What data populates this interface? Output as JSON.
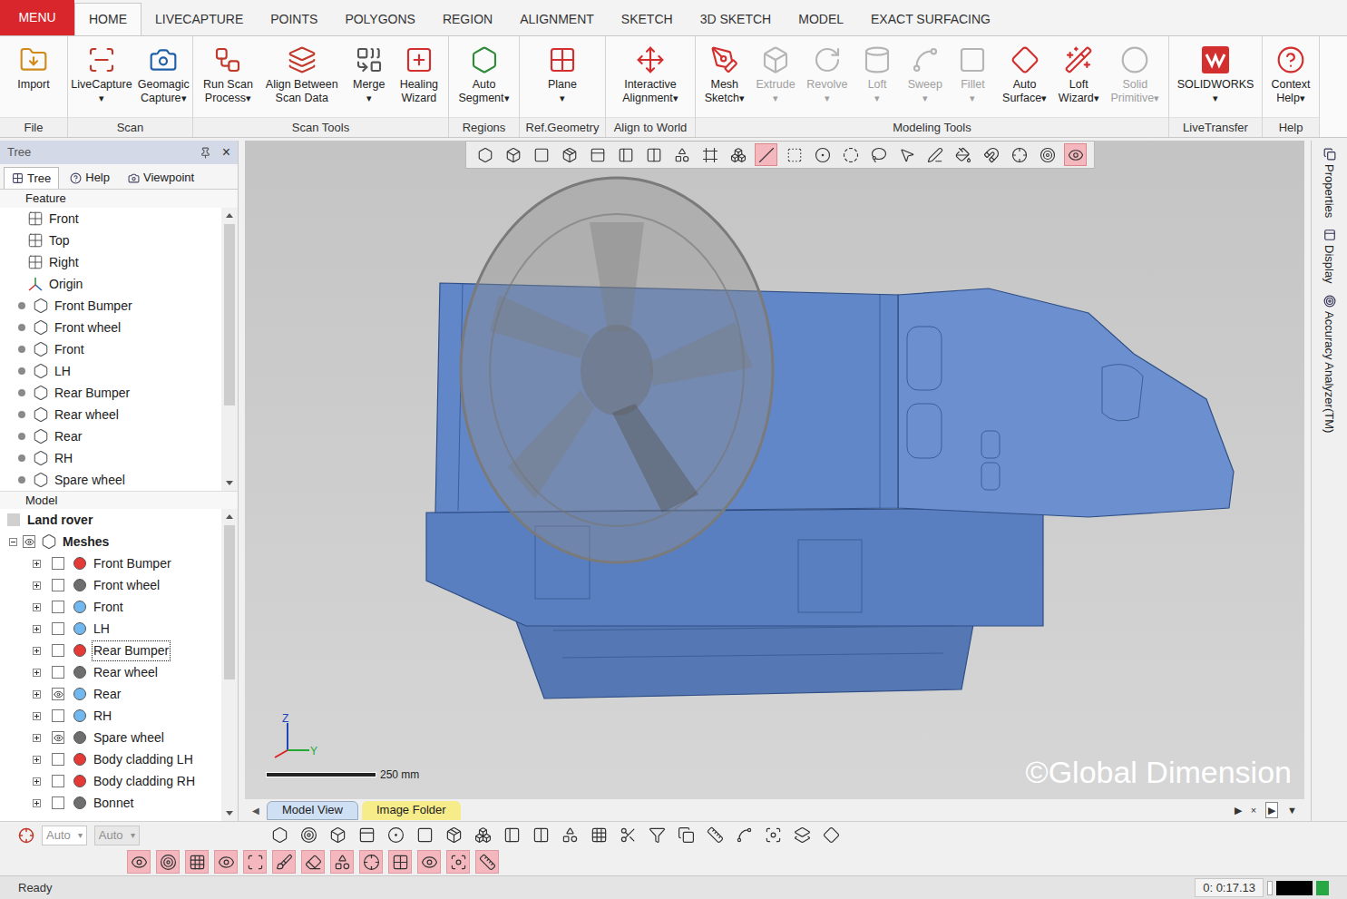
{
  "menu": "MENU",
  "tabs": [
    {
      "label": "HOME",
      "selected": true
    },
    {
      "label": "LIVECAPTURE",
      "selected": false
    },
    {
      "label": "POINTS",
      "selected": false
    },
    {
      "label": "POLYGONS",
      "selected": false
    },
    {
      "label": "REGION",
      "selected": false
    },
    {
      "label": "ALIGNMENT",
      "selected": false
    },
    {
      "label": "SKETCH",
      "selected": false
    },
    {
      "label": "3D SKETCH",
      "selected": false
    },
    {
      "label": "MODEL",
      "selected": false
    },
    {
      "label": "EXACT SURFACING",
      "selected": false
    }
  ],
  "dropdown_glyph": "▾",
  "ribbon_groups": [
    {
      "label": "File",
      "buttons": [
        {
          "lines": [
            "Import"
          ],
          "arrow": "none",
          "disabled": false
        }
      ]
    },
    {
      "label": "Scan",
      "buttons": [
        {
          "lines": [
            "LiveCapture"
          ],
          "arrow": "below",
          "disabled": false
        },
        {
          "lines": [
            "Geomagic",
            "Capture"
          ],
          "arrow": "inline",
          "disabled": false
        }
      ]
    },
    {
      "label": "Scan Tools",
      "buttons": [
        {
          "lines": [
            "Run Scan",
            "Process"
          ],
          "arrow": "inline",
          "disabled": false
        },
        {
          "lines": [
            "Align Between",
            "Scan Data"
          ],
          "arrow": "none",
          "disabled": false
        },
        {
          "lines": [
            "Merge"
          ],
          "arrow": "below",
          "disabled": false
        },
        {
          "lines": [
            "Healing",
            "Wizard"
          ],
          "arrow": "none",
          "disabled": false
        }
      ]
    },
    {
      "label": "Regions",
      "buttons": [
        {
          "lines": [
            "Auto",
            "Segment"
          ],
          "arrow": "inline",
          "disabled": false
        }
      ]
    },
    {
      "label": "Ref.Geometry",
      "buttons": [
        {
          "lines": [
            "Plane"
          ],
          "arrow": "below",
          "disabled": false
        }
      ]
    },
    {
      "label": "Align to World",
      "buttons": [
        {
          "lines": [
            "Interactive",
            "Alignment"
          ],
          "arrow": "inline",
          "disabled": false
        }
      ]
    },
    {
      "label": "Modeling Tools",
      "buttons": [
        {
          "lines": [
            "Mesh",
            "Sketch"
          ],
          "arrow": "inline",
          "disabled": false
        },
        {
          "lines": [
            "Extrude"
          ],
          "arrow": "below",
          "disabled": true
        },
        {
          "lines": [
            "Revolve"
          ],
          "arrow": "below",
          "disabled": true
        },
        {
          "lines": [
            "Loft"
          ],
          "arrow": "below",
          "disabled": true
        },
        {
          "lines": [
            "Sweep"
          ],
          "arrow": "below",
          "disabled": true
        },
        {
          "lines": [
            "Fillet"
          ],
          "arrow": "below",
          "disabled": true
        },
        {
          "lines": [
            "Auto",
            "Surface"
          ],
          "arrow": "inline",
          "disabled": false
        },
        {
          "lines": [
            "Loft",
            "Wizard"
          ],
          "arrow": "inline",
          "disabled": false
        },
        {
          "lines": [
            "Solid",
            "Primitive"
          ],
          "arrow": "inline",
          "disabled": true
        }
      ]
    },
    {
      "label": "LiveTransfer",
      "buttons": [
        {
          "lines": [
            "SOLIDWORKS"
          ],
          "arrow": "below",
          "disabled": false
        }
      ]
    },
    {
      "label": "Help",
      "buttons": [
        {
          "lines": [
            "Context",
            "Help"
          ],
          "arrow": "inline",
          "disabled": false
        }
      ]
    }
  ],
  "tree_panel": {
    "title": "Tree",
    "close": "×",
    "tabs": [
      {
        "label": "Tree",
        "selected": true
      },
      {
        "label": "Help",
        "selected": false
      },
      {
        "label": "Viewpoint",
        "selected": false
      }
    ],
    "feature_header": "Feature",
    "features": [
      {
        "label": "Front",
        "kind": "plane"
      },
      {
        "label": "Top",
        "kind": "plane"
      },
      {
        "label": "Right",
        "kind": "plane"
      },
      {
        "label": "Origin",
        "kind": "origin"
      },
      {
        "label": "Front Bumper",
        "kind": "mesh"
      },
      {
        "label": "Front wheel",
        "kind": "mesh"
      },
      {
        "label": "Front",
        "kind": "mesh"
      },
      {
        "label": "LH",
        "kind": "mesh"
      },
      {
        "label": "Rear Bumper",
        "kind": "mesh"
      },
      {
        "label": "Rear wheel",
        "kind": "mesh"
      },
      {
        "label": "Rear",
        "kind": "mesh"
      },
      {
        "label": "RH",
        "kind": "mesh"
      },
      {
        "label": "Spare wheel",
        "kind": "mesh"
      }
    ],
    "model_header": "Model",
    "root": "Land rover",
    "meshes": {
      "label": "Meshes",
      "expanded": true,
      "visible": true,
      "children": [
        {
          "label": "Front Bumper",
          "visible": false,
          "expanded": false,
          "selected": false,
          "color": "#e53935"
        },
        {
          "label": "Front wheel",
          "visible": false,
          "expanded": false,
          "selected": false,
          "color": "#6e6e6e"
        },
        {
          "label": "Front",
          "visible": false,
          "expanded": false,
          "selected": false,
          "color": "#72b8f0"
        },
        {
          "label": "LH",
          "visible": false,
          "expanded": false,
          "selected": false,
          "color": "#72b8f0"
        },
        {
          "label": "Rear Bumper",
          "visible": false,
          "expanded": false,
          "selected": true,
          "color": "#e53935"
        },
        {
          "label": "Rear wheel",
          "visible": false,
          "expanded": false,
          "selected": false,
          "color": "#6e6e6e"
        },
        {
          "label": "Rear",
          "visible": true,
          "expanded": false,
          "selected": false,
          "color": "#72b8f0"
        },
        {
          "label": "RH",
          "visible": false,
          "expanded": false,
          "selected": false,
          "color": "#72b8f0"
        },
        {
          "label": "Spare wheel",
          "visible": true,
          "expanded": false,
          "selected": false,
          "color": "#6e6e6e"
        },
        {
          "label": "Body cladding LH",
          "visible": false,
          "expanded": false,
          "selected": false,
          "color": "#e53935"
        },
        {
          "label": "Body cladding RH",
          "visible": false,
          "expanded": false,
          "selected": false,
          "color": "#e53935"
        },
        {
          "label": "Bonnet",
          "visible": false,
          "expanded": false,
          "selected": false,
          "color": "#6e6e6e"
        }
      ]
    },
    "fields": [
      {
        "value": "Auto",
        "disabled": false
      },
      {
        "value": "Auto",
        "disabled": true
      }
    ]
  },
  "viewport": {
    "watermark": "©Global Dimension",
    "scale": "250 mm",
    "axes": [
      "Z",
      "Y"
    ],
    "toolbar": [
      {
        "selected": false
      },
      {
        "selected": false
      },
      {
        "selected": false
      },
      {
        "selected": false
      },
      {
        "selected": false
      },
      {
        "selected": false
      },
      {
        "selected": false
      },
      {
        "selected": false
      },
      {
        "selected": false
      },
      {
        "selected": false
      },
      {
        "selected": true
      },
      {
        "selected": false
      },
      {
        "selected": false
      },
      {
        "selected": false
      },
      {
        "selected": false
      },
      {
        "selected": false
      },
      {
        "selected": false
      },
      {
        "selected": false
      },
      {
        "selected": false
      },
      {
        "selected": false
      },
      {
        "selected": false
      },
      {
        "selected": true
      }
    ]
  },
  "view_tabs": [
    {
      "label": "Model View",
      "selected": true,
      "color": "#cfe0f5"
    },
    {
      "label": "Image Folder",
      "selected": false,
      "color": "#f6ec8a"
    }
  ],
  "view_nav": {
    "left": "◀",
    "right": [
      "▶",
      "×",
      "▶",
      "▼"
    ]
  },
  "side_panel": [
    "Properties",
    "Display",
    "Accuracy Analyzer(TM)"
  ],
  "bottom_toolbar": {
    "row1": [
      {
        "active": false
      },
      {
        "active": false
      },
      {
        "active": false
      },
      {
        "active": false
      },
      {
        "active": false
      },
      {
        "active": false
      },
      {
        "active": false
      },
      {
        "active": false
      },
      {
        "active": false
      },
      {
        "active": false
      },
      {
        "active": false
      },
      {
        "active": false
      },
      {
        "active": false
      },
      {
        "active": false
      },
      {
        "active": false
      },
      {
        "active": false
      },
      {
        "active": false
      },
      {
        "active": false
      },
      {
        "active": false
      },
      {
        "active": false
      }
    ],
    "row2": [
      {
        "active": true
      },
      {
        "active": true
      },
      {
        "active": true
      },
      {
        "active": true
      },
      {
        "active": true
      },
      {
        "active": true
      },
      {
        "active": true
      },
      {
        "active": true
      },
      {
        "active": true
      },
      {
        "active": true
      },
      {
        "active": true
      },
      {
        "active": true
      },
      {
        "active": true
      }
    ]
  },
  "status": {
    "text": "Ready",
    "time": "0: 0:17.13"
  }
}
